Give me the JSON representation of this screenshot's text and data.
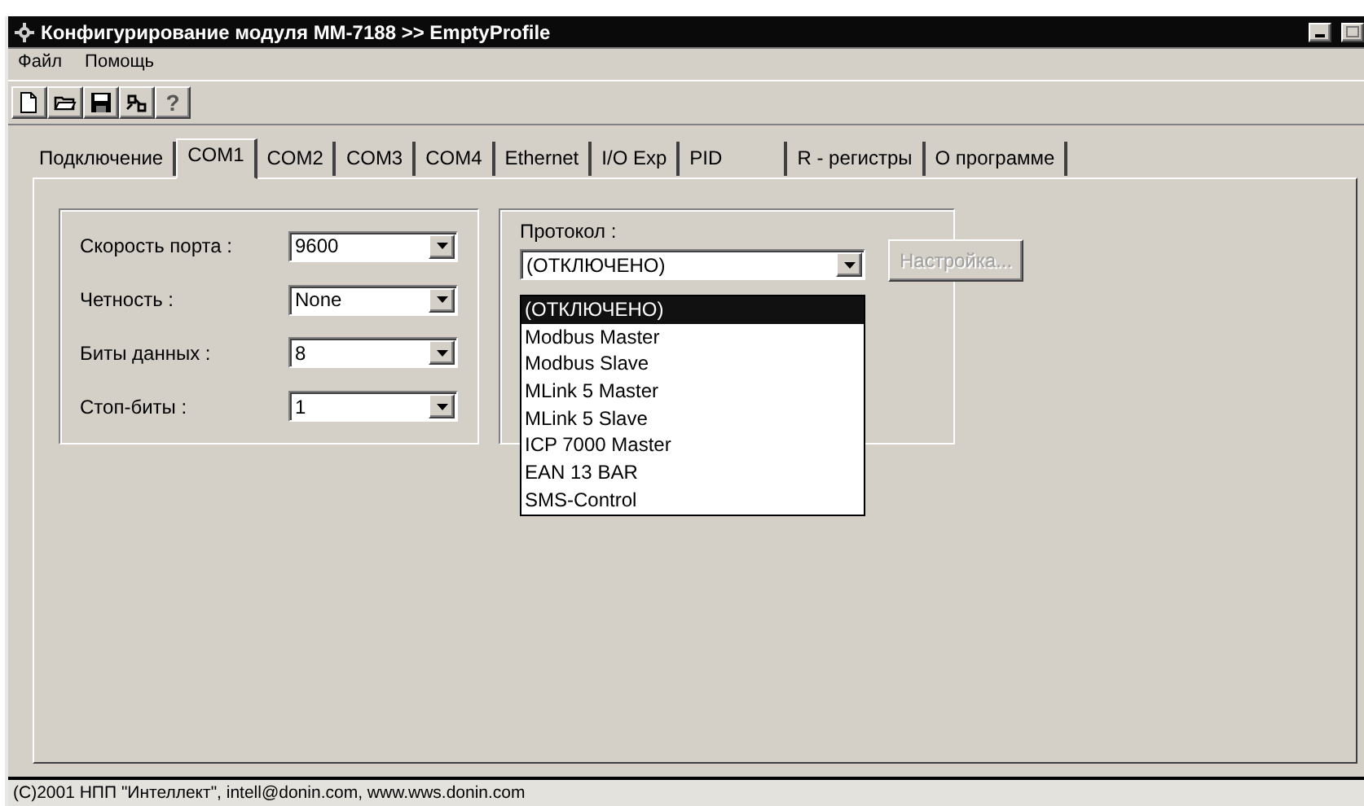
{
  "window": {
    "title": "Конфигурирование модуля MM-7188 >> EmptyProfile"
  },
  "menu": [
    "Файл",
    "Помощь"
  ],
  "toolbar": [
    {
      "kind": "new"
    },
    {
      "kind": "open"
    },
    {
      "kind": "save"
    },
    {
      "kind": "connect"
    },
    {
      "kind": "help",
      "label": "?"
    }
  ],
  "tabs": [
    {
      "label": "Подключение",
      "selected": false
    },
    {
      "label": "COM1",
      "selected": true
    },
    {
      "label": "COM2",
      "selected": false
    },
    {
      "label": "COM3",
      "selected": false
    },
    {
      "label": "COM4",
      "selected": false
    },
    {
      "label": "Ethernet",
      "selected": false
    },
    {
      "label": "I/O Exp",
      "selected": false
    },
    {
      "label": "PID",
      "selected": false
    },
    {
      "label": "R - регистры",
      "selected": false
    },
    {
      "label": "О программе",
      "selected": false
    }
  ],
  "port_settings": [
    {
      "label": "Скорость порта :",
      "value": "9600"
    },
    {
      "label": "Четность :",
      "value": "None"
    },
    {
      "label": "Биты данных :",
      "value": "8"
    },
    {
      "label": "Стоп-биты :",
      "value": "1"
    }
  ],
  "protocol": {
    "label": "Протокол :",
    "value": "(ОТКЛЮЧЕНО)",
    "expanded": true,
    "options": [
      {
        "label": "(ОТКЛЮЧЕНО)",
        "selected": true
      },
      {
        "label": "Modbus Master",
        "selected": false
      },
      {
        "label": "Modbus Slave",
        "selected": false
      },
      {
        "label": "MLink 5 Master",
        "selected": false
      },
      {
        "label": "MLink 5 Slave",
        "selected": false
      },
      {
        "label": "ICP 7000 Master",
        "selected": false
      },
      {
        "label": "EAN 13 BAR",
        "selected": false
      },
      {
        "label": "SMS-Control",
        "selected": false
      }
    ]
  },
  "settings_button": {
    "label": "Настройка...",
    "disabled": true
  },
  "status_bar": "(C)2001 НПП \"Интеллект\", intell@donin.com, www.wws.donin.com"
}
